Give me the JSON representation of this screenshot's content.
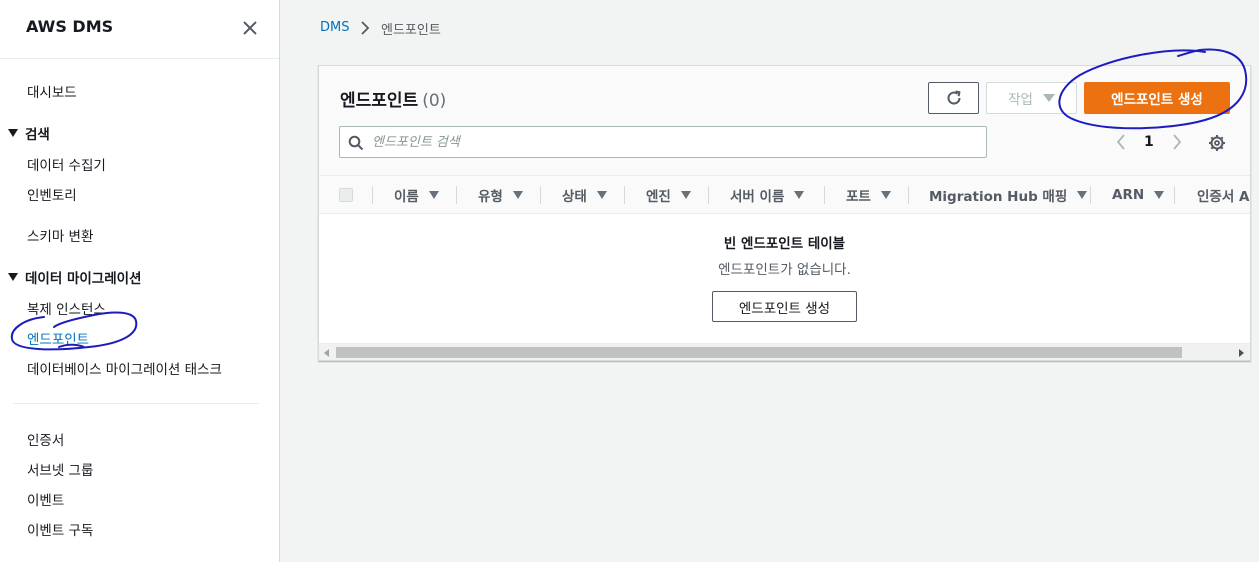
{
  "sidebar": {
    "title": "AWS DMS",
    "dashboard": "대시보드",
    "section_discover": "검색",
    "discover_items": [
      "데이터 수집기",
      "인벤토리"
    ],
    "schema_conversion": "스키마 변환",
    "section_migrate": "데이터 마이그레이션",
    "migrate_items": [
      "복제 인스턴스",
      "엔드포인트",
      "데이터베이스 마이그레이션 태스크"
    ],
    "active_item": "엔드포인트",
    "bottom_items": [
      "인증서",
      "서브넷 그룹",
      "이벤트",
      "이벤트 구독"
    ]
  },
  "breadcrumb": {
    "root": "DMS",
    "current": "엔드포인트"
  },
  "panel": {
    "title": "엔드포인트",
    "count": "(0)",
    "actions_label": "작업",
    "create_label": "엔드포인트 생성",
    "search_placeholder": "엔드포인트 검색",
    "page": "1"
  },
  "table": {
    "columns": [
      "이름",
      "유형",
      "상태",
      "엔진",
      "서버 이름",
      "포트",
      "Migration Hub 매핑",
      "ARN",
      "인증서 A"
    ]
  },
  "empty_state": {
    "title": "빈 엔드포인트 테이블",
    "description": "엔드포인트가 없습니다.",
    "create_label": "엔드포인트 생성"
  },
  "colors": {
    "primary": "#ec7211",
    "link": "#0073bb",
    "annotation": "#1d1dbf"
  },
  "icons": [
    "close-icon",
    "chevron-right-icon",
    "refresh-icon",
    "caret-down-icon",
    "search-icon",
    "chevron-left-icon",
    "settings-gear-icon",
    "sort-icon"
  ]
}
